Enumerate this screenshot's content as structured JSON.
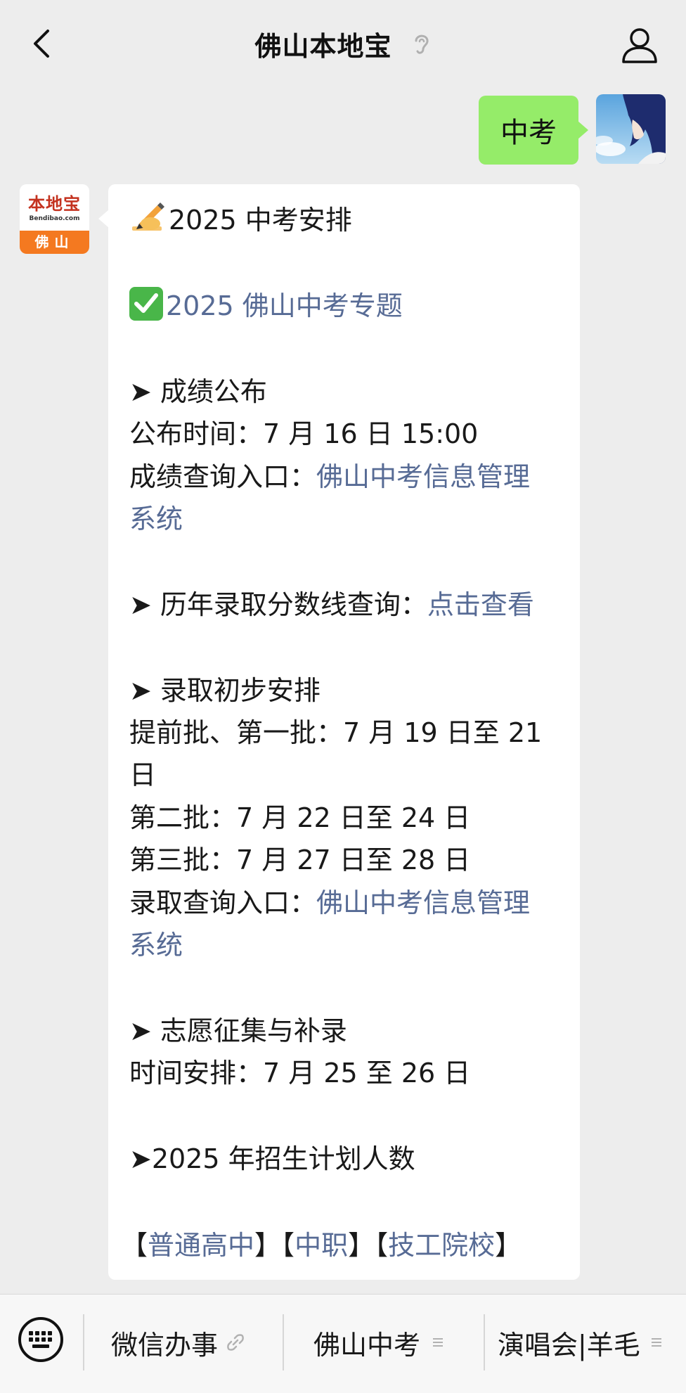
{
  "header": {
    "title": "佛山本地宝"
  },
  "outgoing_message": {
    "text": "中考"
  },
  "account_logo": {
    "brand_cn": "本地宝",
    "brand_en": "Bendibao.com",
    "city": "佛山"
  },
  "article": {
    "heading": "2025 中考安排",
    "topic_link": "2025 佛山中考专题",
    "score_section_title": "➤ 成绩公布",
    "score_time": "公布时间：7 月 16 日 15:00",
    "score_query_label": "成绩查询入口：",
    "score_query_link_part1": "佛山中考信息管理",
    "score_query_link_part2": "系统",
    "history_label": "➤ 历年录取分数线查询：",
    "history_link": "点击查看",
    "admission_title": "➤ 录取初步安排",
    "batch_early_part1": "提前批、第一批：7 月 19 日至 21",
    "batch_early_part2": "日",
    "batch_second": "第二批：7 月 22 日至 24 日",
    "batch_third": "第三批：7 月 27 日至 28 日",
    "admission_query_label": "录取查询入口：",
    "admission_query_link_part1": "佛山中考信息管理",
    "admission_query_link_part2": "系统",
    "supplement_title": "➤ 志愿征集与补录",
    "supplement_time": "时间安排：7 月 25 至 26 日",
    "plan_title": "➤2025 年招生计划人数",
    "bracket_open": "【",
    "bracket_close": "】",
    "plan_links": [
      "普通高中",
      "中职",
      "技工院校"
    ]
  },
  "bottom_menu": {
    "items": [
      "微信办事",
      "佛山中考",
      "演唱会|羊毛"
    ]
  },
  "icons": {
    "back": "chevron-left-icon",
    "ear": "ear-icon",
    "profile": "person-icon",
    "keyboard": "keyboard-icon",
    "link": "link-icon",
    "menu": "menu-lines-icon"
  },
  "colors": {
    "background": "#ededed",
    "outgoing_bubble": "#95ec69",
    "link": "#576b95",
    "logo_orange": "#f47920",
    "logo_red": "#c4321f"
  }
}
